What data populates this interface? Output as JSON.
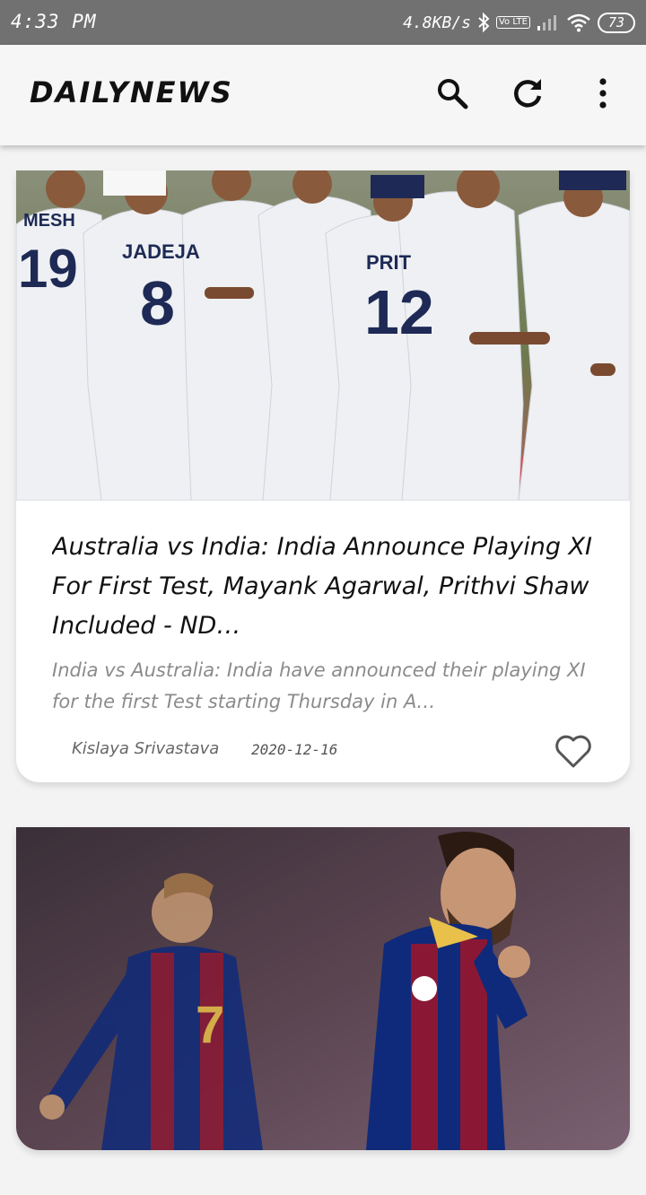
{
  "status_bar": {
    "time": "4:33 PM",
    "net_speed": "4.8KB/s",
    "volte": "Vo LTE",
    "battery": "73",
    "icons": [
      "bluetooth-icon",
      "signal-icon",
      "wifi-icon",
      "battery-icon"
    ]
  },
  "app_bar": {
    "title": "DAILYNEWS",
    "actions": [
      "search-icon",
      "refresh-icon",
      "more-vert-icon"
    ]
  },
  "articles": [
    {
      "image": "cricket-team-photo",
      "jersey_names": [
        "JADEJA",
        "PRIT",
        "MESH"
      ],
      "jersey_numbers": [
        "8",
        "12",
        "19"
      ],
      "headline": "Australia vs India: India Announce Playing XI For First Test, Mayank Agarwal, Prithvi Shaw Included - ND…",
      "summary": "India vs Australia: India have announced their playing XI for the first Test starting Thursday in A…",
      "author": "Kislaya Srivastava",
      "date": "2020-12-16",
      "favorite": false
    },
    {
      "image": "football-players-photo",
      "jersey_numbers": [
        "7"
      ]
    }
  ],
  "colors": {
    "status_bar": "#717171",
    "app_bar": "#f6f6f6",
    "background": "#f3f3f3",
    "headline": "#111111",
    "summary": "#8b8b8b"
  }
}
